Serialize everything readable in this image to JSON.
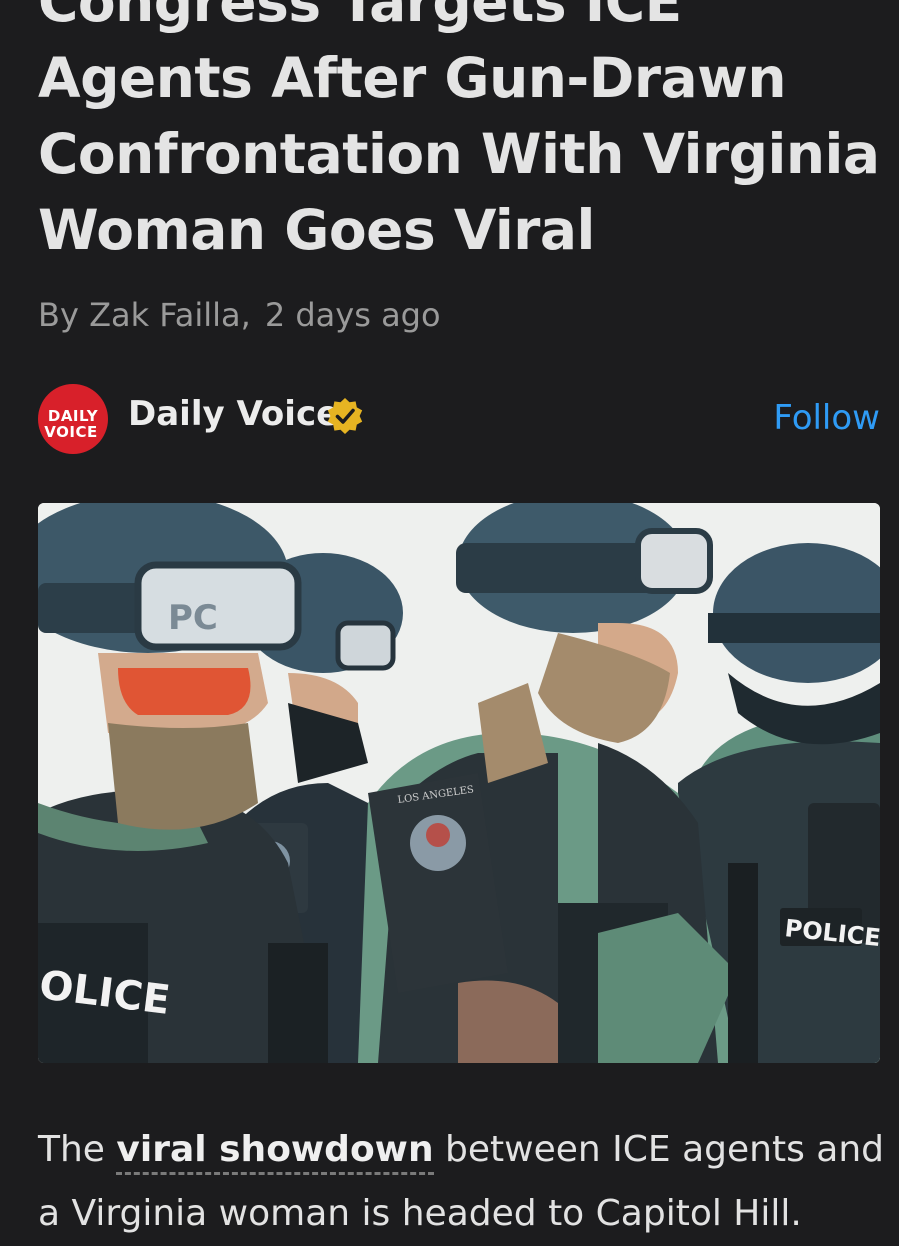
{
  "article": {
    "headline_lines": [
      "Congress Targets ICE",
      "Agents After Gun-Drawn",
      "Confrontation With Virginia",
      "Woman Goes Viral"
    ],
    "byline_author": "By Zak Failla,",
    "byline_time": "2 days ago"
  },
  "publisher": {
    "name": "Daily Voice",
    "logo_line1": "DAILY",
    "logo_line2": "VOICE",
    "verified_icon": "verified-badge-icon",
    "follow_label": "Follow",
    "logo_color": "#d8202a",
    "verified_color": "#e6b422",
    "follow_color": "#2f9bf5"
  },
  "hero_image": {
    "patch_texts": [
      "PO",
      "POLICE",
      "OLICE"
    ]
  },
  "body": {
    "intro_before": "The ",
    "intro_link": "viral showdown",
    "intro_after": " between ICE agents and a Virginia woman is headed to Capitol Hill."
  }
}
